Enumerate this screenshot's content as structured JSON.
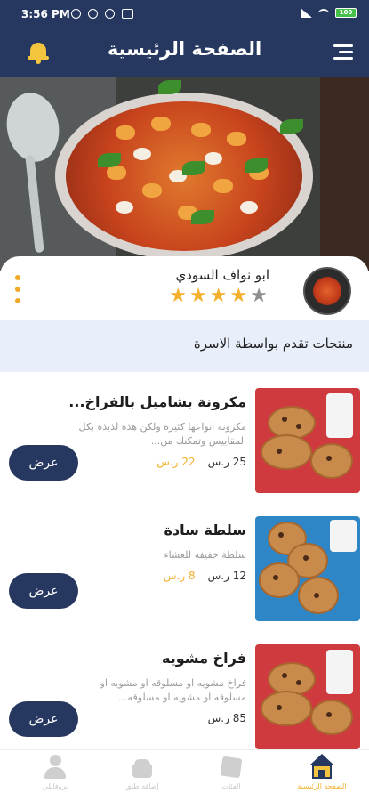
{
  "status_bar": {
    "time": "3:56 PM",
    "battery": "100"
  },
  "header": {
    "title": "الصفحة الرئيسية"
  },
  "chef": {
    "name": "ابو نواف السودي",
    "rating": 4,
    "rating_max": 5
  },
  "section": {
    "title": "منتجات تقدم بواسطة الاسرة"
  },
  "products": [
    {
      "name": "مكرونة بشاميل بالفراخ...",
      "description": "مكرونه انواعها كثيرة ولكن هذه لذيذة بكل المقاييس وتمكنك من...",
      "old_price": "25 ر.س",
      "new_price": "22 ر.س",
      "button": "عرض"
    },
    {
      "name": "سلطة سادة",
      "description": "سلطة خفيفه للعشاء",
      "old_price": "12 ر.س",
      "new_price": "8 ر.س",
      "button": "عرض"
    },
    {
      "name": "فراخ مشويه",
      "description": "فراخ مشويه او مسلوقه او مشويه او مسلوقه او مشويه او مسلوقه...",
      "old_price": "85 ر.س",
      "new_price": "",
      "button": "عرض"
    }
  ],
  "bottom_nav": {
    "home": "الصفحة الرئيسية",
    "categories": "الفئات",
    "add_dish": "إضافة طبق",
    "profile": "بروفايلي"
  },
  "colors": {
    "primary": "#263760",
    "accent": "#f2b02c",
    "section_bg": "#e9eefb"
  }
}
